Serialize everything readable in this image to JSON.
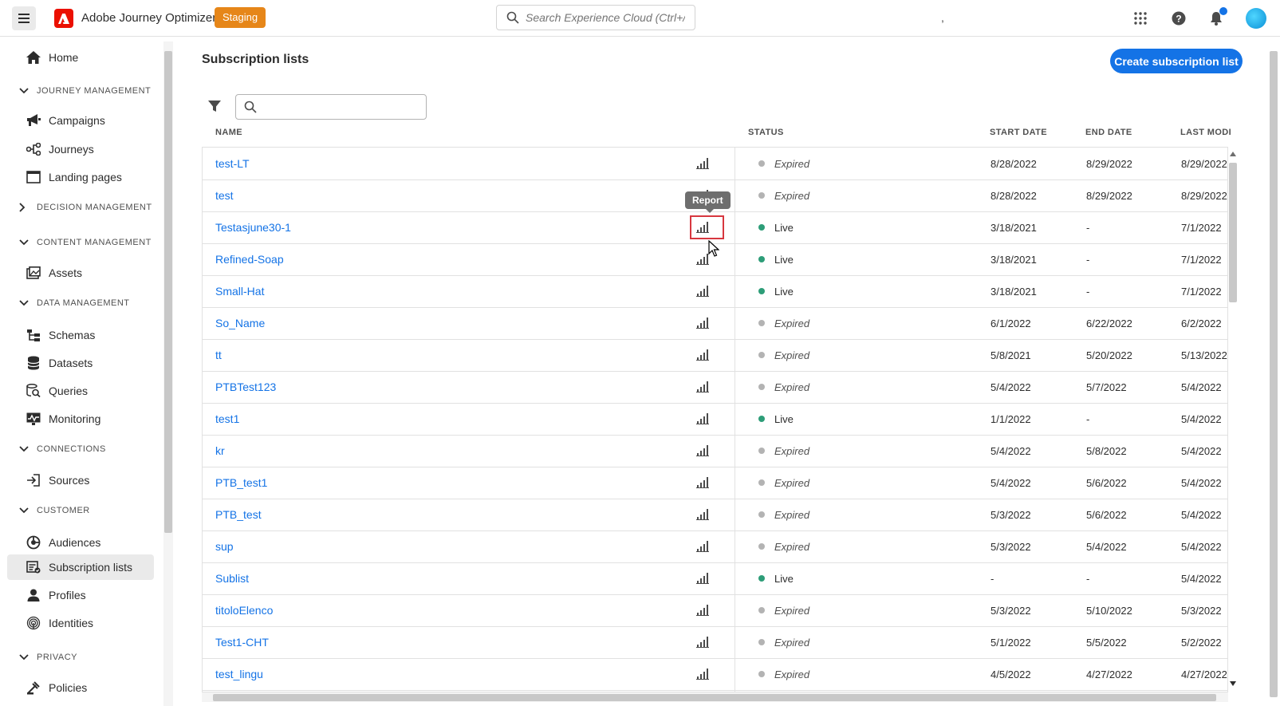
{
  "header": {
    "app_title": "Adobe Journey Optimizer",
    "env_badge": "Staging",
    "search_placeholder": "Search Experience Cloud (Ctrl+/)",
    "comma": ","
  },
  "sidebar": {
    "home": "Home",
    "journey_management": "JOURNEY MANAGEMENT",
    "campaigns": "Campaigns",
    "journeys": "Journeys",
    "landing_pages": "Landing pages",
    "decision_management": "DECISION MANAGEMENT",
    "content_management": "CONTENT MANAGEMENT",
    "assets": "Assets",
    "data_management": "DATA MANAGEMENT",
    "schemas": "Schemas",
    "datasets": "Datasets",
    "queries": "Queries",
    "monitoring": "Monitoring",
    "connections": "CONNECTIONS",
    "sources": "Sources",
    "customer": "CUSTOMER",
    "audiences": "Audiences",
    "subscription_lists": "Subscription lists",
    "profiles": "Profiles",
    "identities": "Identities",
    "privacy": "PRIVACY",
    "policies": "Policies"
  },
  "main": {
    "title": "Subscription lists",
    "create_button": "Create subscription list",
    "columns": {
      "name": "NAME",
      "status": "STATUS",
      "start_date": "START DATE",
      "end_date": "END DATE",
      "last_modified": "LAST MODI"
    },
    "tooltip": "Report",
    "rows": [
      {
        "name": "test-LT",
        "status": "Expired",
        "start": "8/28/2022",
        "end": "8/29/2022",
        "modified": "8/29/2022"
      },
      {
        "name": "test",
        "status": "Expired",
        "start": "8/28/2022",
        "end": "8/29/2022",
        "modified": "8/29/2022"
      },
      {
        "name": "Testasjune30-1",
        "status": "Live",
        "start": "3/18/2021",
        "end": "-",
        "modified": "7/1/2022"
      },
      {
        "name": "Refined-Soap",
        "status": "Live",
        "start": "3/18/2021",
        "end": "-",
        "modified": "7/1/2022"
      },
      {
        "name": "Small-Hat",
        "status": "Live",
        "start": "3/18/2021",
        "end": "-",
        "modified": "7/1/2022"
      },
      {
        "name": "So_Name",
        "status": "Expired",
        "start": "6/1/2022",
        "end": "6/22/2022",
        "modified": "6/2/2022"
      },
      {
        "name": "tt",
        "status": "Expired",
        "start": "5/8/2021",
        "end": "5/20/2022",
        "modified": "5/13/2022"
      },
      {
        "name": "PTBTest123",
        "status": "Expired",
        "start": "5/4/2022",
        "end": "5/7/2022",
        "modified": "5/4/2022"
      },
      {
        "name": "test1",
        "status": "Live",
        "start": "1/1/2022",
        "end": "-",
        "modified": "5/4/2022"
      },
      {
        "name": "kr",
        "status": "Expired",
        "start": "5/4/2022",
        "end": "5/8/2022",
        "modified": "5/4/2022"
      },
      {
        "name": "PTB_test1",
        "status": "Expired",
        "start": "5/4/2022",
        "end": "5/6/2022",
        "modified": "5/4/2022"
      },
      {
        "name": "PTB_test",
        "status": "Expired",
        "start": "5/3/2022",
        "end": "5/6/2022",
        "modified": "5/4/2022"
      },
      {
        "name": "sup",
        "status": "Expired",
        "start": "5/3/2022",
        "end": "5/4/2022",
        "modified": "5/4/2022"
      },
      {
        "name": "Sublist",
        "status": "Live",
        "start": "-",
        "end": "-",
        "modified": "5/4/2022"
      },
      {
        "name": "titoloElenco",
        "status": "Expired",
        "start": "5/3/2022",
        "end": "5/10/2022",
        "modified": "5/3/2022"
      },
      {
        "name": "Test1-CHT",
        "status": "Expired",
        "start": "5/1/2022",
        "end": "5/5/2022",
        "modified": "5/2/2022"
      },
      {
        "name": "test_lingu",
        "status": "Expired",
        "start": "4/5/2022",
        "end": "4/27/2022",
        "modified": "4/27/2022"
      }
    ]
  },
  "colors": {
    "accent": "#1473e6",
    "live": "#2d9d78",
    "expired": "#b3b3b3",
    "badge": "#e68619",
    "highlight": "#d7373f"
  }
}
